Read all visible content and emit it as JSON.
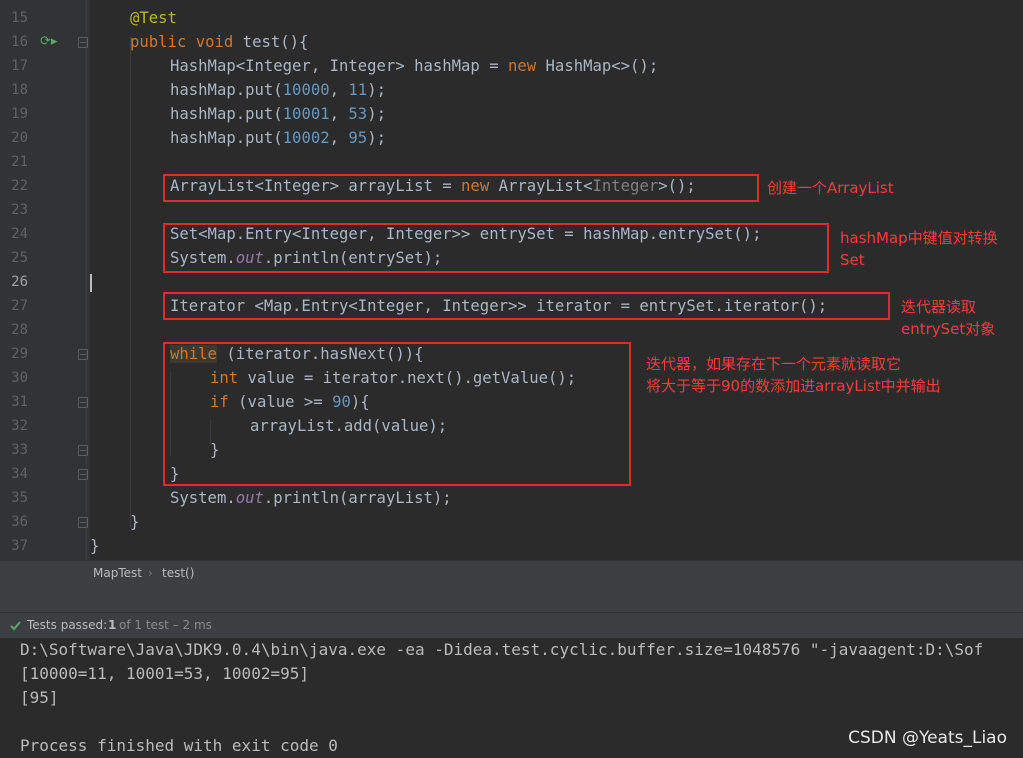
{
  "editor": {
    "line_numbers": [
      "15",
      "16",
      "17",
      "18",
      "19",
      "20",
      "21",
      "22",
      "23",
      "24",
      "25",
      "26",
      "27",
      "28",
      "29",
      "30",
      "31",
      "32",
      "33",
      "34",
      "35",
      "36",
      "37"
    ],
    "code": {
      "l15_ann": "@Test",
      "l16_kw1": "public",
      "l16_kw2": "void",
      "l16_rest": " test(){",
      "l17_a": "HashMap<Integer, Integer> hashMap = ",
      "l17_kw": "new",
      "l17_b": " HashMap<>();",
      "l18_a": "hashMap.put(",
      "l18_n1": "10000",
      "l18_c": ", ",
      "l18_n2": "11",
      "l18_e": ");",
      "l19_a": "hashMap.put(",
      "l19_n1": "10001",
      "l19_c": ", ",
      "l19_n2": "53",
      "l19_e": ");",
      "l20_a": "hashMap.put(",
      "l20_n1": "10002",
      "l20_c": ", ",
      "l20_n2": "95",
      "l20_e": ");",
      "l22_a": "ArrayList<Integer> arrayList = ",
      "l22_kw": "new",
      "l22_b": " ArrayList<",
      "l22_gray": "Integer",
      "l22_e": ">();",
      "l24": "Set<Map.Entry<Integer, Integer>> entrySet = hashMap.entrySet();",
      "l25_a": "System.",
      "l25_f": "out",
      "l25_b": ".println(entrySet);",
      "l27": "Iterator <Map.Entry<Integer, Integer>> iterator = entrySet.iterator();",
      "l29_kw": "while",
      "l29_rest": " (iterator.hasNext()){",
      "l30_kw": "int",
      "l30_rest": " value = iterator.next().getValue();",
      "l31_kw": "if",
      "l31_a": " (value >= ",
      "l31_n": "90",
      "l31_b": "){",
      "l32": "arrayList.add(value);",
      "l33": "}",
      "l34": "}",
      "l35_a": "System.",
      "l35_f": "out",
      "l35_b": ".println(arrayList);",
      "l36": "}",
      "l37": "}"
    }
  },
  "annotations": {
    "note1": "创建一个ArrayList",
    "note2": "hashMap中键值对转换\nSet",
    "note3": "迭代器读取\nentrySet对象",
    "note4": "迭代器，如果存在下一个元素就读取它\n将大于等于90的数添加进arrayList中并输出"
  },
  "breadcrumb": {
    "class_name": "MapTest",
    "separator": "›",
    "method_name": "test()"
  },
  "test_status": {
    "icon": "check-icon",
    "label": "Tests passed:",
    "count": "1",
    "detail": "of 1 test – 2 ms"
  },
  "console": {
    "lines": [
      "D:\\Software\\Java\\JDK9.0.4\\bin\\java.exe -ea -Didea.test.cyclic.buffer.size=1048576 \"-javaagent:D:\\Sof",
      "[10000=11, 10001=53, 10002=95]",
      "[95]",
      "",
      "Process finished with exit code 0"
    ]
  },
  "watermark": "CSDN @Yeats_Liao",
  "colors": {
    "background": "#2b2b2b",
    "keyword": "#cc7832",
    "number": "#6897bb",
    "annotation_box": "#e02c2c",
    "annotation_text": "#ff3b3b",
    "pass_green": "#59a869"
  }
}
